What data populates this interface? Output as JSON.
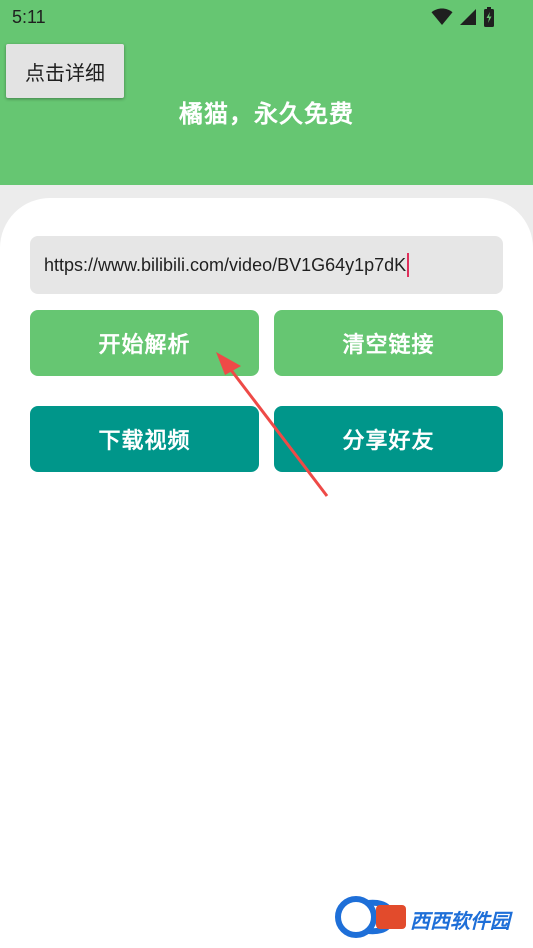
{
  "status_bar": {
    "time": "5:11",
    "icons": [
      "wifi-icon",
      "cell-signal-icon",
      "battery-icon"
    ]
  },
  "header": {
    "details_button_label": "点击详细",
    "title": "橘猫，永久免费"
  },
  "url_input": {
    "value": "https://www.bilibili.com/video/BV1G64y1p7dK"
  },
  "buttons": {
    "parse": "开始解析",
    "clear": "清空链接",
    "download": "下载视频",
    "share": "分享好友"
  },
  "watermark": {
    "text": "西西软件园"
  },
  "colors": {
    "primary_green": "#66c672",
    "teal": "#00968a",
    "annotation_red": "#ee4a47"
  }
}
